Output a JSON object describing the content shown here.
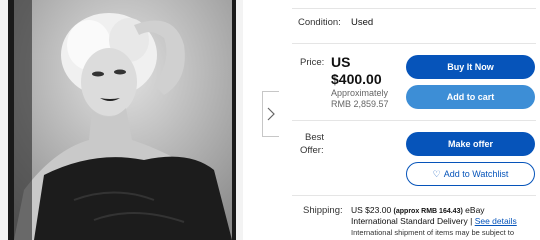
{
  "listing": {
    "photo_alt": "Vintage black and white portrait photograph",
    "condition": {
      "label": "Condition:",
      "value": "Used"
    },
    "price": {
      "label": "Price:",
      "currency": "US",
      "amount": "$400.00",
      "approx_label": "Approximately",
      "approx_value": "RMB 2,859.57"
    },
    "best_offer": {
      "label_line1": "Best",
      "label_line2": "Offer:"
    },
    "buttons": {
      "buy_now": "Buy It Now",
      "add_to_cart": "Add to cart",
      "make_offer": "Make offer",
      "add_to_watchlist": "Add to Watchlist"
    },
    "shipping": {
      "label": "Shipping:",
      "cost": "US $23.00",
      "cost_approx": "(approx RMB 164.43)",
      "carrier_prefix": "eBay",
      "carrier": "International Standard Delivery",
      "separator": "|",
      "see_details": "See details",
      "note": "International shipment of items may be subject to"
    }
  },
  "icons": {
    "next": "chevron-right-icon",
    "heart": "heart-icon"
  },
  "colors": {
    "primary": "#0654ba",
    "secondary": "#3d8ed6",
    "divider": "#e5e5e5"
  }
}
